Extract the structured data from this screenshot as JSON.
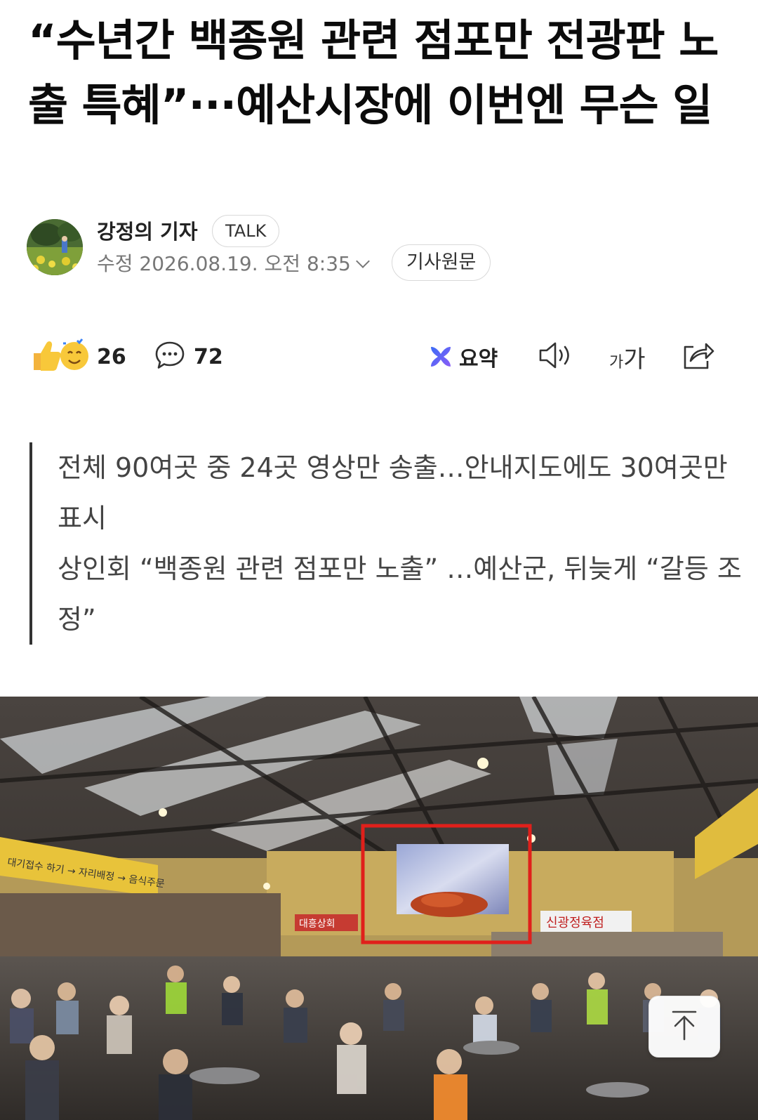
{
  "article": {
    "headline": "“수년간 백종원 관련 점포만 전광판 노출 특혜”···예산시장에 이번엔 무슨 일",
    "author": {
      "name": "강정의 기자",
      "talk_label": "TALK",
      "timestamp": "수정 2026.08.19. 오전 8:35",
      "original_label": "기사원문"
    },
    "actions": {
      "reaction_count": "26",
      "comment_count": "72",
      "summary_label": "요약",
      "fontsize_small": "가",
      "fontsize_large": "가"
    },
    "subheadlines": [
      "전체 90여곳 중 24곳 영상만 송출…안내지도에도 30여곳만 표시",
      "상인회 “백종원 관련 점포만 노출” …예산군, 뒤늦게 “갈등 조정”"
    ],
    "photo": {
      "sign_left": "대기접수 하기 → 자리배정 → 음식주문",
      "sign_store": "신광정육점",
      "sign_store2": "대흥상회",
      "highlight_color": "#e0201b"
    }
  },
  "icons": {
    "reaction": "thumbs-up-emoji-icon",
    "comment": "comment-bubble-icon",
    "summary": "summary-sparkle-icon",
    "listen": "speaker-icon",
    "fontsize": "font-size-icon",
    "share": "share-icon",
    "scroll_top": "arrow-up-to-top-icon"
  },
  "colors": {
    "summary_icon_a": "#3b6cf6",
    "summary_icon_b": "#8a5cf6",
    "emoji_yellow": "#f8c83a"
  }
}
